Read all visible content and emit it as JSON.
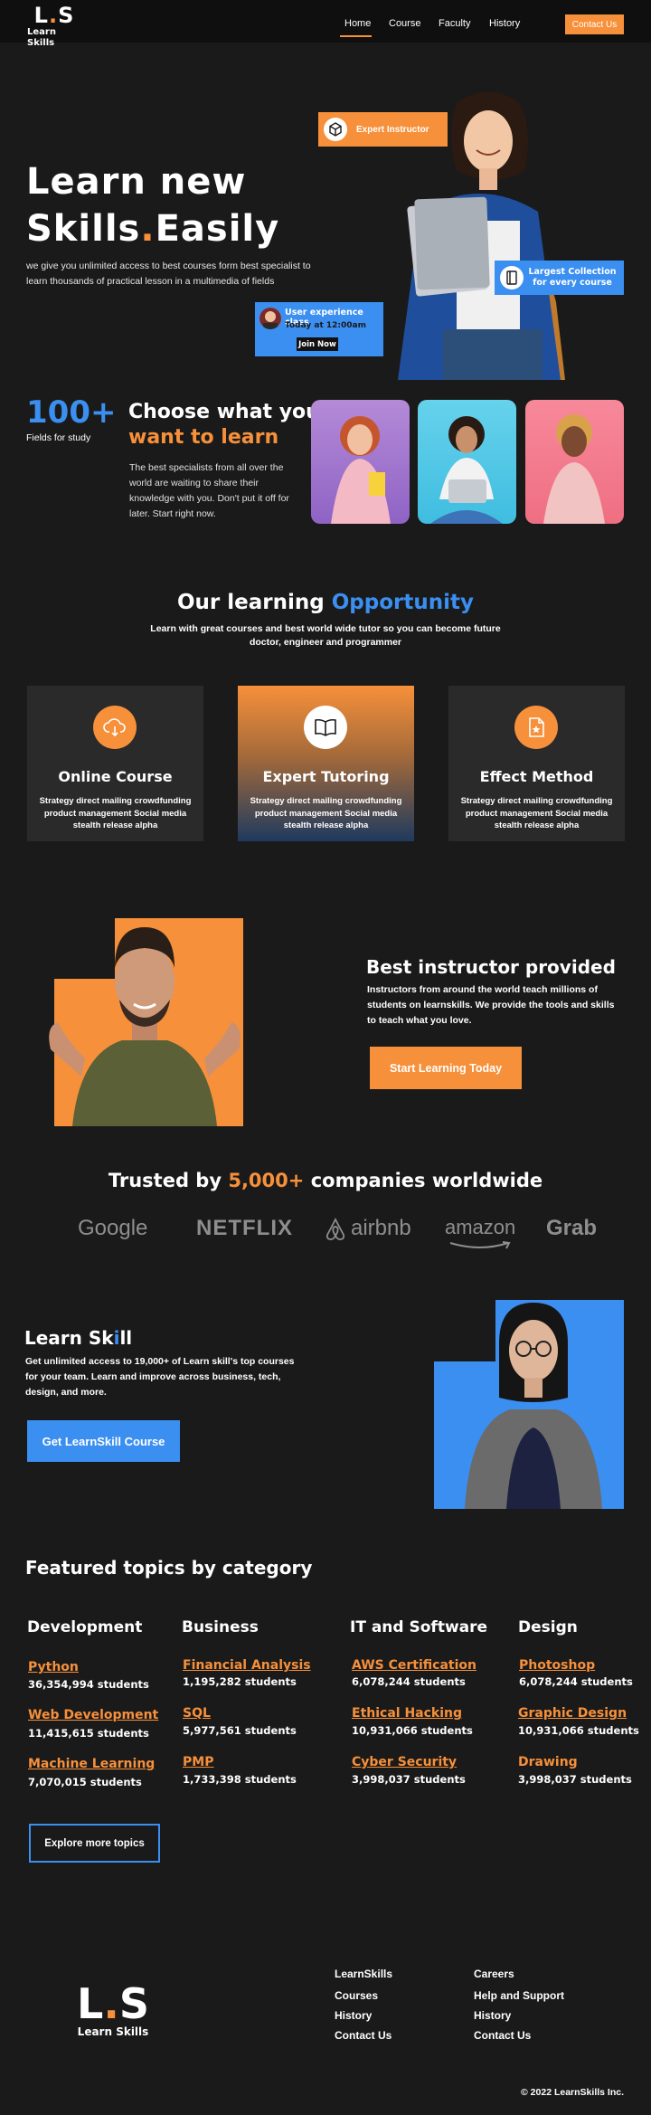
{
  "nav": {
    "logo_mark_l": "L",
    "logo_mark_dot": ".",
    "logo_mark_s": "S",
    "logo_name": "Learn Skills",
    "links": [
      "Home",
      "Course",
      "Faculty",
      "History"
    ],
    "active": "Home",
    "contact_label": "Contact Us"
  },
  "hero": {
    "title_line1": "Learn new",
    "title_line2_a": "Skills",
    "title_line2_dot": ".",
    "title_line2_b": "Easily",
    "subtitle": "we give you unlimited access to best courses form best specialist to learn thousands of practical lesson in a multimedia of fields",
    "badge_expert": "Expert Instructor",
    "badge_collection": "Largest Collection for every course",
    "ux_title": "User experience class",
    "ux_time": "Today at 12:00am",
    "ux_join": "Join Now"
  },
  "stats": {
    "number": "100+",
    "label": "Fields for study"
  },
  "choose": {
    "title_a": "Choose what you",
    "title_b": "want to learn",
    "text": "The best specialists from all over the world are waiting to share their knowledge with you. Don't put it off for later. Start right now."
  },
  "opportunity": {
    "title_a": "Our learning",
    "title_b": "Opportunity",
    "subtitle": "Learn with great courses and best world wide tutor so you can become future doctor, engineer and programmer",
    "cards": [
      {
        "title": "Online Course",
        "text": "Strategy direct mailing crowdfunding product management Social media stealth release alpha",
        "icon": "cloud-download-icon"
      },
      {
        "title": "Expert Tutoring",
        "text": "Strategy direct mailing crowdfunding product management Social media stealth release alpha",
        "icon": "book-open-icon"
      },
      {
        "title": "Effect Method",
        "text": "Strategy direct mailing crowdfunding product management Social media stealth release alpha",
        "icon": "document-star-icon"
      }
    ]
  },
  "instructor": {
    "title": "Best instructor provided",
    "text": "Instructors from around the world teach millions of students on learnskills. We provide the tools and skills to teach what you love.",
    "button": "Start Learning Today"
  },
  "trusted": {
    "prefix": "Trusted by",
    "count": "5,000+",
    "suffix": "companies worldwide",
    "brands": [
      "Google",
      "NETFLIX",
      "airbnb",
      "amazon",
      "Grab"
    ]
  },
  "learnskill": {
    "title_a": "Learn Sk",
    "title_i": "i",
    "title_b": "ll",
    "text": "Get unlimited access to 19,000+ of Learn skill's top courses for your team. Learn and improve across business, tech, design, and more.",
    "button": "Get LearnSkill Course"
  },
  "topics": {
    "title": "Featured topics by category",
    "categories": [
      {
        "name": "Development",
        "items": [
          {
            "topic": "Python",
            "students": "36,354,994 students"
          },
          {
            "topic": "Web Development",
            "students": "11,415,615 students"
          },
          {
            "topic": "Machine Learning",
            "students": "7,070,015 students"
          }
        ]
      },
      {
        "name": "Business",
        "items": [
          {
            "topic": "Financial Analysis",
            "students": "1,195,282 students"
          },
          {
            "topic": "SQL",
            "students": "5,977,561 students"
          },
          {
            "topic": "PMP",
            "students": "1,733,398 students"
          }
        ]
      },
      {
        "name": "IT and Software",
        "items": [
          {
            "topic": "AWS Certification",
            "students": "6,078,244 students"
          },
          {
            "topic": "Ethical Hacking",
            "students": "10,931,066 students"
          },
          {
            "topic": "Cyber Security",
            "students": "3,998,037 students"
          }
        ]
      },
      {
        "name": "Design",
        "items": [
          {
            "topic": "Photoshop",
            "students": "6,078,244 students"
          },
          {
            "topic": "Graphic Design",
            "students": "10,931,066 students"
          },
          {
            "topic": "Drawing",
            "students": "3,998,037 students"
          }
        ]
      }
    ],
    "explore": "Explore more topics"
  },
  "footer": {
    "col1": [
      "LearnSkills",
      "Courses",
      "History",
      "Contact Us"
    ],
    "col2": [
      "Careers",
      "Help and Support",
      "History",
      "Contact Us"
    ],
    "copyright": "© 2022 LearnSkills Inc."
  },
  "colors": {
    "accent": "#f7903a",
    "blue": "#3b8ff1",
    "bg": "#1a1a1a"
  }
}
